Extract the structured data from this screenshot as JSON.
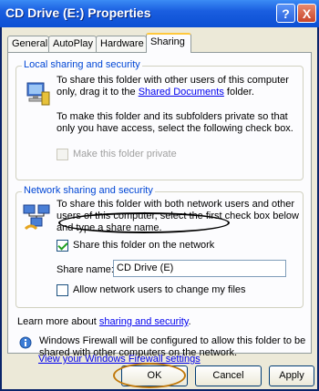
{
  "window": {
    "title": "CD Drive (E:) Properties",
    "help_label": "?",
    "close_label": "X"
  },
  "tabs": [
    {
      "label": "General",
      "active": false
    },
    {
      "label": "AutoPlay",
      "active": false
    },
    {
      "label": "Hardware",
      "active": false
    },
    {
      "label": "Sharing",
      "active": true
    }
  ],
  "local": {
    "legend": "Local sharing and security",
    "text1_a": "To share this folder with other users of this computer",
    "text1_b": "only, drag it to the ",
    "text1_link": "Shared Documents",
    "text1_c": " folder.",
    "text2_a": "To make this folder and its subfolders private so that",
    "text2_b": "only you have access, select the following check box.",
    "private_label": "Make this folder private"
  },
  "network": {
    "legend": "Network sharing and security",
    "text_a": "To share this folder with both network users and other",
    "text_b": "users of this computer, select the first check box below",
    "text_c": "and type a share name.",
    "share_label": "Share this folder on the network",
    "share_name_label": "Share name:",
    "share_name_value": "CD Drive (E)",
    "allow_label": "Allow network users to change my files",
    "learn_prefix": "Learn more about ",
    "learn_link": "sharing and security",
    "learn_suffix": "."
  },
  "firewall": {
    "text_a": "Windows Firewall will be configured to allow this folder to be",
    "text_b": "shared with other computers on the network.",
    "link": "View your Windows Firewall settings"
  },
  "buttons": {
    "ok": "OK",
    "cancel": "Cancel",
    "apply": "Apply"
  }
}
